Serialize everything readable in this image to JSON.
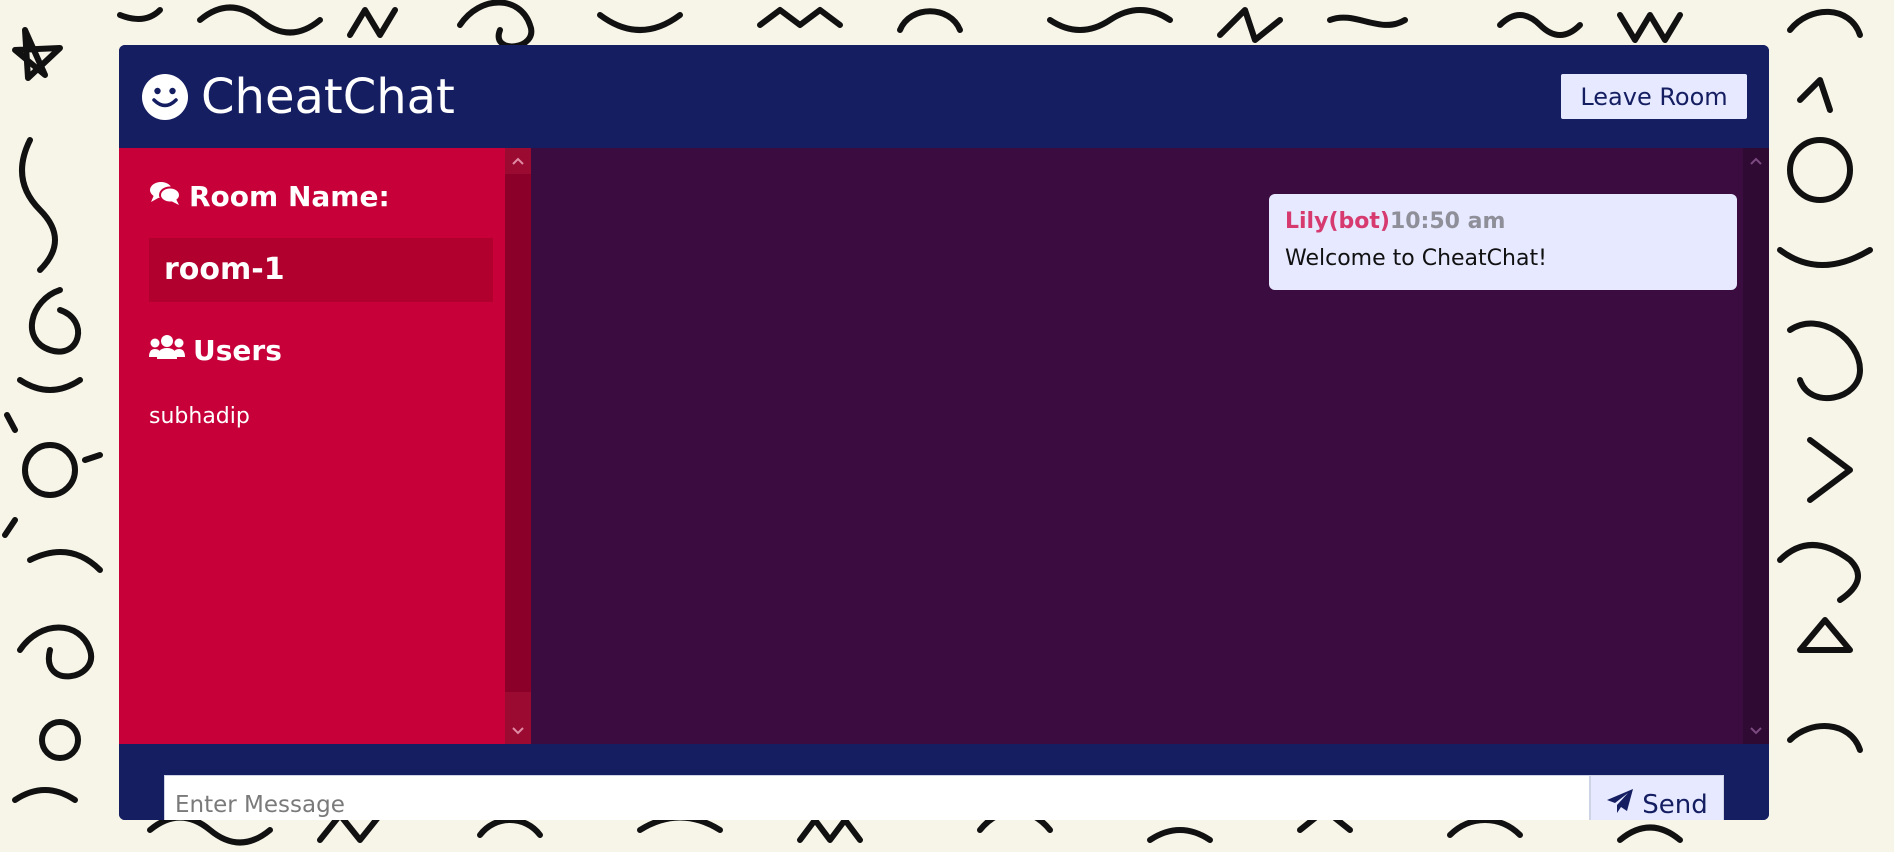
{
  "header": {
    "app_title": "CheatChat",
    "logo_icon": "smile-icon",
    "leave_button_label": "Leave Room"
  },
  "sidebar": {
    "room_heading": "Room Name:",
    "room_heading_icon": "comments-icon",
    "room_name": "room-1",
    "users_heading": "Users",
    "users_heading_icon": "users-icon",
    "users": [
      "subhadip"
    ]
  },
  "messages": [
    {
      "author": "Lily(bot)",
      "time": "10:50 am",
      "text": "Welcome to CheatChat!"
    }
  ],
  "composer": {
    "placeholder": "Enter Message",
    "value": "",
    "send_label": "Send",
    "send_icon": "paper-plane-icon"
  },
  "colors": {
    "header_bg": "#141e61",
    "sidebar_bg": "#c70039",
    "messages_bg": "#3a0c3f",
    "message_bubble_bg": "#e6e9ff",
    "author_color": "#d63a6e",
    "time_color": "#8f8f99"
  }
}
